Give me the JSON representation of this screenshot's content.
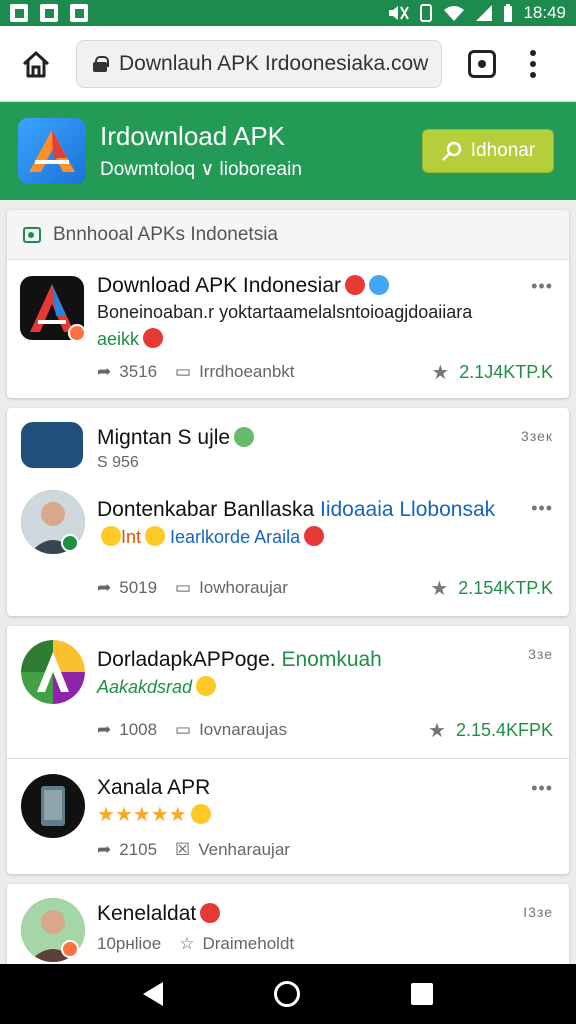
{
  "status_bar": {
    "time": "18:49",
    "colors": {
      "bg": "#1d8a4e"
    }
  },
  "browser": {
    "url": "Downlauh APK Irdoonesiaka.cow",
    "icons": [
      "home-icon",
      "lock-icon",
      "tabs-icon",
      "overflow-menu-icon"
    ]
  },
  "app_header": {
    "title": "Irdownload APK",
    "subtitle": "Dowmtoloq ∨ lioboreain",
    "download_label": "Idhonar",
    "colors": {
      "bg": "#239b57",
      "button": "#b5cf3c"
    }
  },
  "section": {
    "title": "Bnnhooal APKs Indonetsia"
  },
  "posts": [
    {
      "title": "Download APK Indonesiar",
      "line1": "Boneinoaban.r yoktartaamelalsntoioagjdoaiiara",
      "line2": "aeikk",
      "views": "3516",
      "comment_label": "Irrdhoeanbkt",
      "count": "2.1J4KTP.K"
    },
    {
      "title": "Migntan S ujle",
      "line1": "S 956",
      "meta": "3зек"
    },
    {
      "title": "Dontenkabar Banllaska",
      "title_tail": "Iidoaaia Llobonsak",
      "line1_a": "Int",
      "line1_b": "Iearlkorde Araila",
      "views": "5019",
      "comment_label": "Iowhoraujar",
      "count": "2.154KTP.K"
    },
    {
      "title": "DorladapkAPPoge.",
      "title_tail": "Enomkuah",
      "line1": "Aakakdsrad",
      "meta": "3зе",
      "views": "1008",
      "comment_label": "Iovnaraujas",
      "count": "2.15.4KFPK"
    },
    {
      "title": "Xanala APR",
      "views": "2105",
      "comment_label": "Venharaujar",
      "rating": 5
    },
    {
      "title": "Kenelaldat",
      "line1": "10рнlioe",
      "meta_label": "Draimeholdt",
      "meta": "I3зе"
    }
  ],
  "nav": {
    "icons": [
      "back-icon",
      "home-circle-icon",
      "recents-icon"
    ]
  }
}
